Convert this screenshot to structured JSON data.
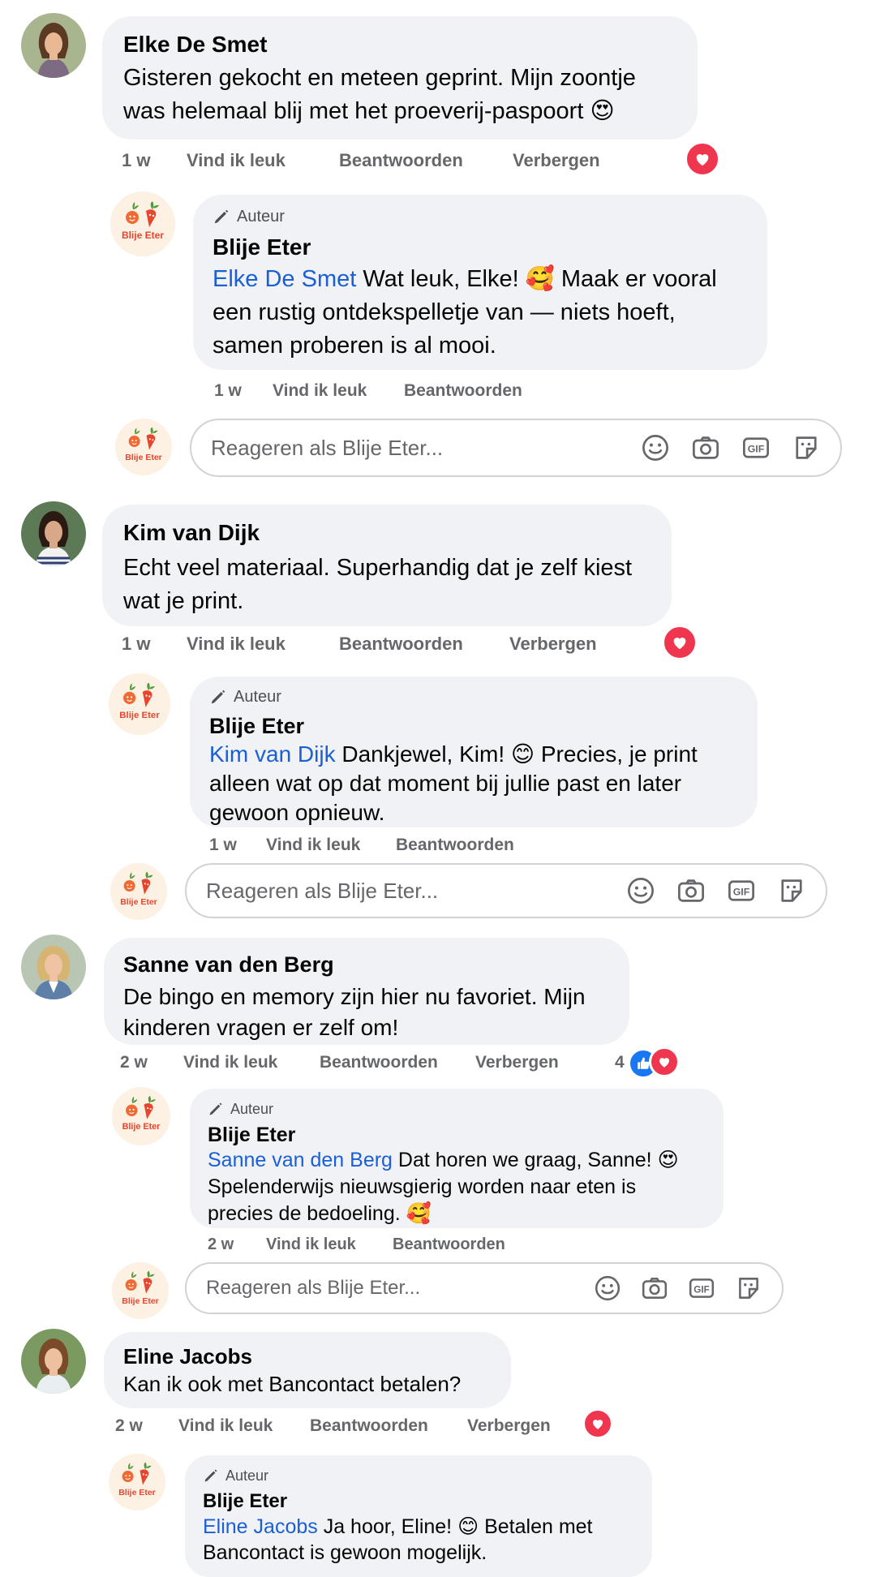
{
  "colors": {
    "bubble": "#f0f2f5",
    "link": "#1b5fd6",
    "meta": "#65676b",
    "heart": "#f0364f",
    "like": "#1877f2"
  },
  "comments": [
    {
      "name": "Elke De Smet",
      "text": "Gisteren gekocht en meteen geprint. Mijn zoontje was helemaal blij met het proeverij-paspoort 😍",
      "time": "1 w",
      "like": "Vind ik leuk",
      "reply": "Beantwoorden",
      "hide": "Verbergen",
      "reply_comment": {
        "author_label": "Auteur",
        "name": "Blije Eter",
        "tag": "Elke De Smet",
        "text": " Wat leuk, Elke! 🥰 Maak er vooral een rustig ontdekspelletje van — niets hoeft, samen proberen is al mooi.",
        "time": "1 w",
        "like": "Vind ik leuk",
        "reply": "Beantwoorden"
      },
      "input_placeholder": "Reageren als Blije Eter..."
    },
    {
      "name": "Kim van Dijk",
      "text": "Echt veel materiaal. Superhandig dat je zelf kiest wat je print.",
      "time": "1 w",
      "like": "Vind ik leuk",
      "reply": "Beantwoorden",
      "hide": "Verbergen",
      "reply_comment": {
        "author_label": "Auteur",
        "name": "Blije Eter",
        "tag": "Kim van Dijk",
        "text": " Dankjewel, Kim! 😊 Precies, je print alleen wat op dat moment bij jullie past en later gewoon opnieuw.",
        "time": "1 w",
        "like": "Vind ik leuk",
        "reply": "Beantwoorden"
      },
      "input_placeholder": "Reageren als Blije Eter..."
    },
    {
      "name": "Sanne van den Berg",
      "text": "De bingo en memory zijn hier nu favoriet. Mijn kinderen vragen er zelf om!",
      "time": "2 w",
      "like": "Vind ik leuk",
      "reply": "Beantwoorden",
      "hide": "Verbergen",
      "reaction_count": "4",
      "reply_comment": {
        "author_label": "Auteur",
        "name": "Blije Eter",
        "tag": "Sanne van den Berg",
        "text": " Dat horen we graag, Sanne! 😍 Spelenderwijs nieuwsgierig worden naar eten is precies de bedoeling. 🥰",
        "time": "2 w",
        "like": "Vind ik leuk",
        "reply": "Beantwoorden"
      },
      "input_placeholder": "Reageren als Blije Eter..."
    },
    {
      "name": "Eline Jacobs",
      "text": "Kan ik ook met Bancontact betalen?",
      "time": "2 w",
      "like": "Vind ik leuk",
      "reply": "Beantwoorden",
      "hide": "Verbergen",
      "reply_comment": {
        "author_label": "Auteur",
        "name": "Blije Eter",
        "tag": "Eline Jacobs",
        "text": " Ja hoor, Eline! 😊 Betalen met Bancontact is gewoon mogelijk."
      }
    }
  ],
  "brand": {
    "logo_text": "Blije Eter"
  }
}
